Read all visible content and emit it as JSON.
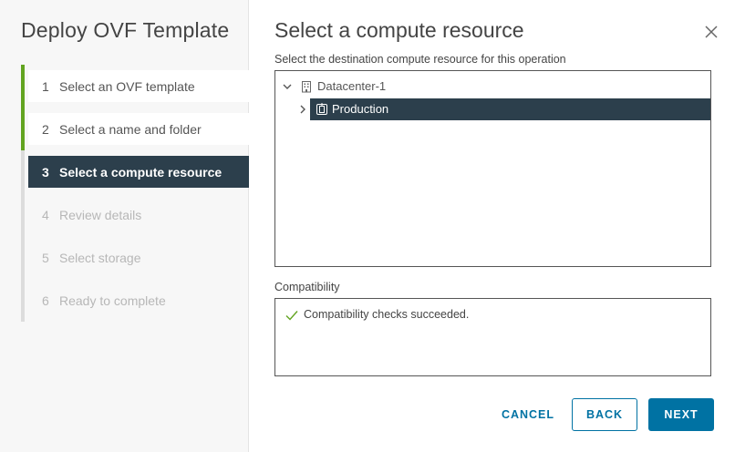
{
  "wizard": {
    "title": "Deploy OVF Template",
    "steps": [
      {
        "num": "1",
        "label": "Select an OVF template",
        "state": "done"
      },
      {
        "num": "2",
        "label": "Select a name and folder",
        "state": "done"
      },
      {
        "num": "3",
        "label": "Select a compute resource",
        "state": "active"
      },
      {
        "num": "4",
        "label": "Review details",
        "state": "pending"
      },
      {
        "num": "5",
        "label": "Select storage",
        "state": "pending"
      },
      {
        "num": "6",
        "label": "Ready to complete",
        "state": "pending"
      }
    ]
  },
  "page": {
    "title": "Select a compute resource",
    "subtitle": "Select the destination compute resource for this operation",
    "close_icon": "close-icon"
  },
  "tree": {
    "root": {
      "label": "Datacenter-1",
      "icon": "datacenter-icon",
      "expanded": true
    },
    "child": {
      "label": "Production",
      "icon": "cluster-icon",
      "expanded": false,
      "selected": true
    }
  },
  "compatibility": {
    "label": "Compatibility",
    "message": "Compatibility checks succeeded.",
    "status_icon": "check-icon",
    "status_color": "#62a420"
  },
  "footer": {
    "cancel_label": "CANCEL",
    "back_label": "BACK",
    "next_label": "NEXT"
  },
  "colors": {
    "accent": "#0072a3",
    "active_step": "#2c3f4c",
    "done_bar": "#62a420"
  }
}
